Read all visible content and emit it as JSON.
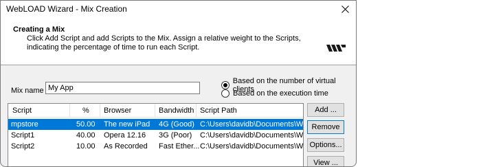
{
  "window": {
    "title": "WebLOAD Wizard - Mix Creation"
  },
  "header": {
    "title": "Creating a Mix",
    "description": "Click Add Script and add Scripts to the Mix. Assign a relative weight to the Scripts, indicating the percentage of time to run each Script."
  },
  "mix": {
    "label": "Mix name :",
    "value": "My App"
  },
  "options": {
    "by_clients": "Based on the number of virtual clients",
    "by_time": "Based on the execution time",
    "selected": "by_clients"
  },
  "table": {
    "columns": [
      "Script",
      "%",
      "Browser",
      "Bandwidth",
      "Script Path"
    ],
    "rows": [
      {
        "script": "mpstore",
        "pct": "50.00",
        "browser": "The new iPad",
        "bandwidth": "4G (Good)",
        "path": "C:\\Users\\davidb\\Documents\\WebL",
        "selected": true
      },
      {
        "script": "Script1",
        "pct": "40.00",
        "browser": "Opera 12.16",
        "bandwidth": "3G (Poor)",
        "path": "C:\\Users\\davidb\\Documents\\WebL",
        "selected": false
      },
      {
        "script": "Script2",
        "pct": "10.00",
        "browser": "As Recorded",
        "bandwidth": "Fast Ether...",
        "path": "C:\\Users\\davidb\\Documents\\WebL",
        "selected": false
      }
    ]
  },
  "buttons": {
    "add": "Add ...",
    "remove": "Remove",
    "options": "Options...",
    "view": "View ..."
  },
  "icons": {
    "close": "close-icon",
    "logo": "webload-logo-icon"
  },
  "colors": {
    "selection": "#0078d7",
    "window_bg": "#f0f0f0"
  }
}
